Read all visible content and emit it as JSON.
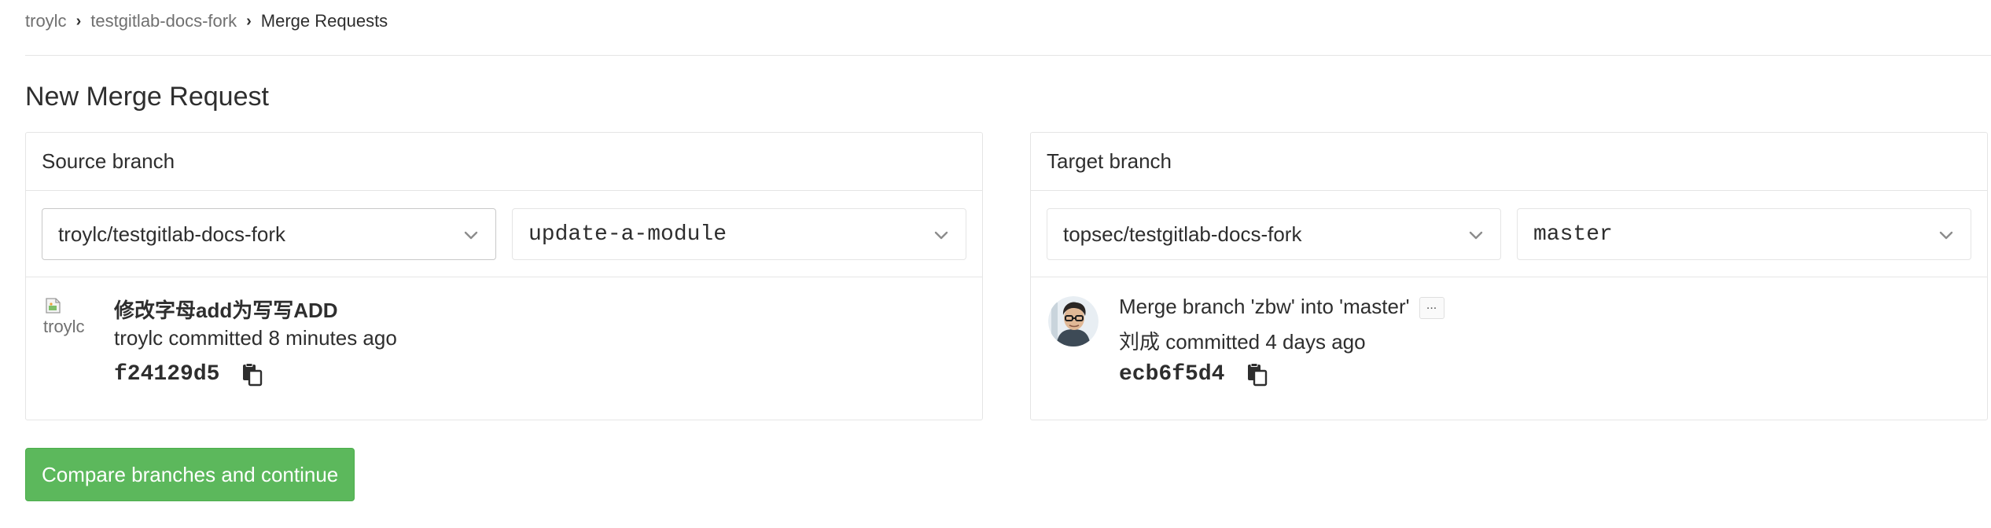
{
  "breadcrumb": {
    "items": [
      "troylc",
      "testgitlab-docs-fork"
    ],
    "current": "Merge Requests"
  },
  "page_title": "New Merge Request",
  "source": {
    "header": "Source branch",
    "project": "troylc/testgitlab-docs-fork",
    "branch": "update-a-module",
    "commit": {
      "avatar_alt": "troylc",
      "title": "修改字母add为写写ADD",
      "meta": "troylc committed 8 minutes ago",
      "sha": "f24129d5"
    }
  },
  "target": {
    "header": "Target branch",
    "project": "topsec/testgitlab-docs-fork",
    "branch": "master",
    "commit": {
      "title": "Merge branch 'zbw' into 'master'",
      "ellipsis": "...",
      "meta": "刘成 committed 4 days ago",
      "sha": "ecb6f5d4"
    }
  },
  "compare_button": "Compare branches and continue",
  "icons": {
    "chevron": "chevron-down-icon",
    "copy": "copy-icon",
    "broken_image": "broken-image-icon"
  },
  "colors": {
    "button_green": "#5cb85c",
    "border": "#e5e5e5",
    "text": "#2e2e2e",
    "muted": "#707070"
  }
}
